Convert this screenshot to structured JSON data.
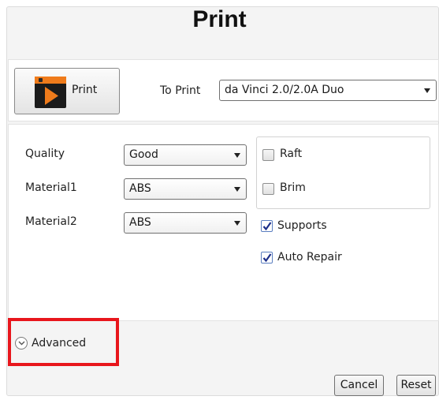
{
  "title": "Print",
  "print_button": {
    "label": "Print"
  },
  "to_print": {
    "label": "To Print",
    "value": "da Vinci 2.0/2.0A Duo"
  },
  "quality": {
    "label": "Quality",
    "value": "Good"
  },
  "material1": {
    "label": "Material1",
    "value": "ABS"
  },
  "material2": {
    "label": "Material2",
    "value": "ABS"
  },
  "options": {
    "raft": {
      "label": "Raft",
      "checked": false
    },
    "brim": {
      "label": "Brim",
      "checked": false
    },
    "supports": {
      "label": "Supports",
      "checked": true
    },
    "auto_repair": {
      "label": "Auto Repair",
      "checked": true
    }
  },
  "advanced": {
    "label": "Advanced",
    "icon": "chevron-down-icon",
    "highlight_color": "#e8161c"
  },
  "buttons": {
    "cancel": "Cancel",
    "reset": "Reset"
  }
}
